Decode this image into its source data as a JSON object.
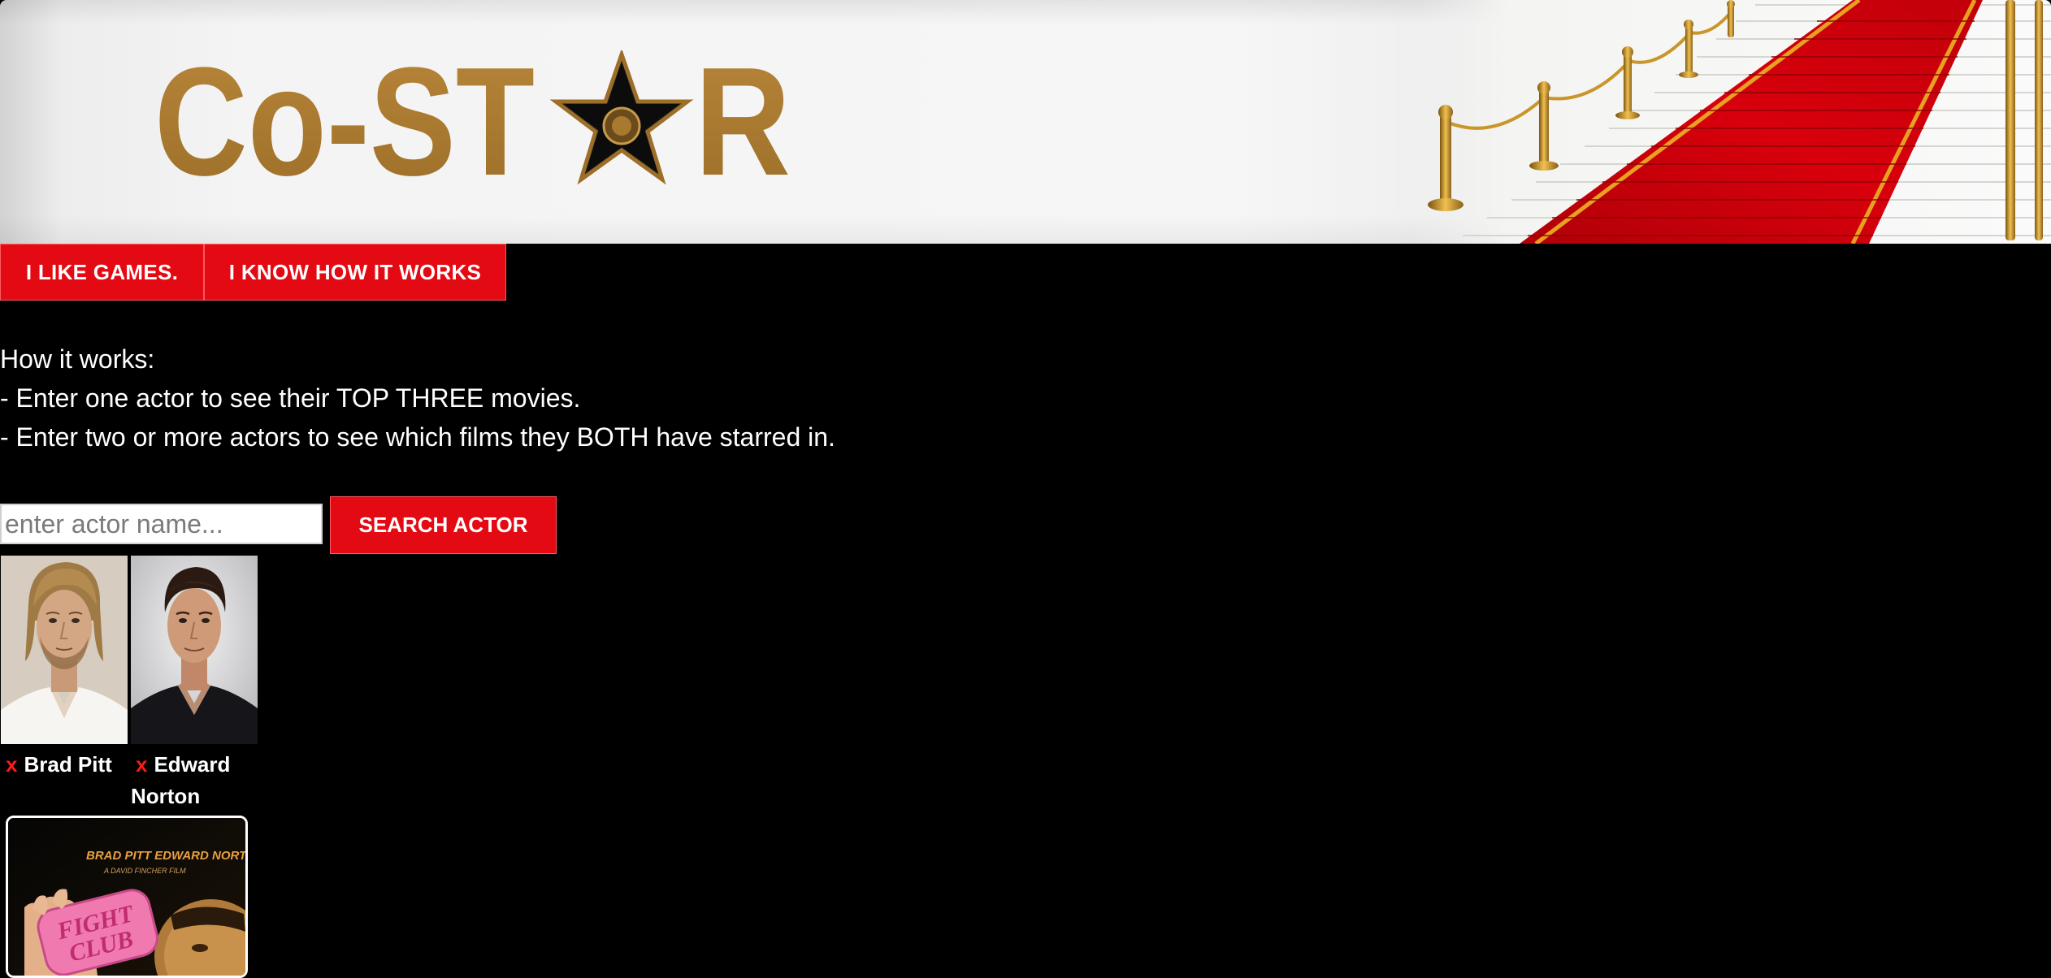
{
  "banner": {
    "logo_text": "Co-ST R"
  },
  "nav": {
    "games_label": "I LIKE GAMES.",
    "how_label": "I KNOW HOW IT WORKS"
  },
  "instructions": {
    "heading": "How it works:",
    "line1": "- Enter one actor to see their TOP THREE movies.",
    "line2": "- Enter two or more actors to see which films they BOTH have starred in."
  },
  "search": {
    "placeholder": "enter actor name...",
    "value": "",
    "button_label": "SEARCH ACTOR"
  },
  "actors": [
    {
      "name_line1": "Brad Pitt",
      "name_line2": "",
      "remove_label": "x"
    },
    {
      "name_line1": "Edward",
      "name_line2": "Norton",
      "remove_label": "x"
    }
  ],
  "movie": {
    "poster_credits": "BRAD PITT  EDWARD NORTON",
    "poster_sub": "A DAVID FINCHER FILM",
    "poster_title_line1": "FIGHT",
    "poster_title_line2": "CLUB"
  },
  "colors": {
    "accent_red": "#e30a13",
    "logo_gold": "#a87a30",
    "background": "#000000"
  }
}
